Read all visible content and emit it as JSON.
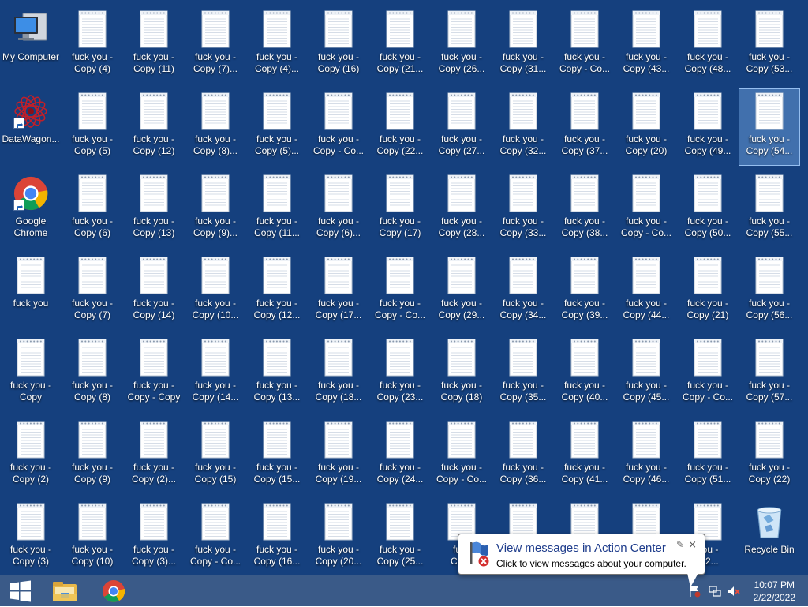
{
  "desktop": {
    "background": "#15407e",
    "columns": [
      [
        {
          "label": "My Computer",
          "kind": "computer"
        },
        {
          "label": "DataWagon...",
          "kind": "datawagon",
          "shortcut": true
        },
        {
          "label": "Google\nChrome",
          "kind": "chrome",
          "shortcut": true
        },
        {
          "label": "fuck you",
          "kind": "file"
        },
        {
          "label": "fuck you -\nCopy",
          "kind": "file"
        },
        {
          "label": "fuck you -\nCopy (2)",
          "kind": "file"
        },
        {
          "label": "fuck you -\nCopy (3)",
          "kind": "file"
        }
      ],
      [
        {
          "label": "fuck you -\nCopy (4)",
          "kind": "file"
        },
        {
          "label": "fuck you -\nCopy (5)",
          "kind": "file"
        },
        {
          "label": "fuck you -\nCopy (6)",
          "kind": "file"
        },
        {
          "label": "fuck you -\nCopy (7)",
          "kind": "file"
        },
        {
          "label": "fuck you -\nCopy (8)",
          "kind": "file"
        },
        {
          "label": "fuck you -\nCopy (9)",
          "kind": "file"
        },
        {
          "label": "fuck you -\nCopy (10)",
          "kind": "file"
        }
      ],
      [
        {
          "label": "fuck you -\nCopy (11)",
          "kind": "file"
        },
        {
          "label": "fuck you -\nCopy (12)",
          "kind": "file"
        },
        {
          "label": "fuck you -\nCopy (13)",
          "kind": "file"
        },
        {
          "label": "fuck you -\nCopy (14)",
          "kind": "file"
        },
        {
          "label": "fuck you -\nCopy - Copy",
          "kind": "file"
        },
        {
          "label": "fuck you -\nCopy (2)...",
          "kind": "file"
        },
        {
          "label": "fuck you -\nCopy (3)...",
          "kind": "file"
        }
      ],
      [
        {
          "label": "fuck you -\nCopy (7)...",
          "kind": "file"
        },
        {
          "label": "fuck you -\nCopy (8)...",
          "kind": "file"
        },
        {
          "label": "fuck you -\nCopy (9)...",
          "kind": "file"
        },
        {
          "label": "fuck you -\nCopy (10...",
          "kind": "file"
        },
        {
          "label": "fuck you -\nCopy (14...",
          "kind": "file"
        },
        {
          "label": "fuck you -\nCopy (15)",
          "kind": "file"
        },
        {
          "label": "fuck you -\nCopy - Co...",
          "kind": "file"
        }
      ],
      [
        {
          "label": "fuck you -\nCopy (4)...",
          "kind": "file"
        },
        {
          "label": "fuck you -\nCopy (5)...",
          "kind": "file"
        },
        {
          "label": "fuck you -\nCopy (11...",
          "kind": "file"
        },
        {
          "label": "fuck you -\nCopy (12...",
          "kind": "file"
        },
        {
          "label": "fuck you -\nCopy (13...",
          "kind": "file"
        },
        {
          "label": "fuck you -\nCopy (15...",
          "kind": "file"
        },
        {
          "label": "fuck you -\nCopy (16...",
          "kind": "file"
        }
      ],
      [
        {
          "label": "fuck you -\nCopy (16)",
          "kind": "file"
        },
        {
          "label": "fuck you -\nCopy - Co...",
          "kind": "file"
        },
        {
          "label": "fuck you -\nCopy (6)...",
          "kind": "file"
        },
        {
          "label": "fuck you -\nCopy (17...",
          "kind": "file"
        },
        {
          "label": "fuck you -\nCopy (18...",
          "kind": "file"
        },
        {
          "label": "fuck you -\nCopy (19...",
          "kind": "file"
        },
        {
          "label": "fuck you -\nCopy (20...",
          "kind": "file"
        }
      ],
      [
        {
          "label": "fuck you -\nCopy (21...",
          "kind": "file"
        },
        {
          "label": "fuck you -\nCopy (22...",
          "kind": "file"
        },
        {
          "label": "fuck you -\nCopy (17)",
          "kind": "file"
        },
        {
          "label": "fuck you -\nCopy - Co...",
          "kind": "file"
        },
        {
          "label": "fuck you -\nCopy (23...",
          "kind": "file"
        },
        {
          "label": "fuck you -\nCopy (24...",
          "kind": "file"
        },
        {
          "label": "fuck you -\nCopy (25...",
          "kind": "file"
        }
      ],
      [
        {
          "label": "fuck you -\nCopy (26...",
          "kind": "file"
        },
        {
          "label": "fuck you -\nCopy (27...",
          "kind": "file"
        },
        {
          "label": "fuck you -\nCopy (28...",
          "kind": "file"
        },
        {
          "label": "fuck you -\nCopy (29...",
          "kind": "file"
        },
        {
          "label": "fuck you -\nCopy (18)",
          "kind": "file"
        },
        {
          "label": "fuck you -\nCopy - Co...",
          "kind": "file"
        },
        {
          "label": "fuck\nCopy",
          "kind": "file"
        }
      ],
      [
        {
          "label": "fuck you -\nCopy (31...",
          "kind": "file"
        },
        {
          "label": "fuck you -\nCopy (32...",
          "kind": "file"
        },
        {
          "label": "fuck you -\nCopy (33...",
          "kind": "file"
        },
        {
          "label": "fuck you -\nCopy (34...",
          "kind": "file"
        },
        {
          "label": "fuck you -\nCopy (35...",
          "kind": "file"
        },
        {
          "label": "fuck you -\nCopy (36...",
          "kind": "file"
        },
        {
          "label": "",
          "kind": "file"
        }
      ],
      [
        {
          "label": "fuck you -\nCopy - Co...",
          "kind": "file"
        },
        {
          "label": "fuck you -\nCopy (37...",
          "kind": "file"
        },
        {
          "label": "fuck you -\nCopy (38...",
          "kind": "file"
        },
        {
          "label": "fuck you -\nCopy (39...",
          "kind": "file"
        },
        {
          "label": "fuck you -\nCopy (40...",
          "kind": "file"
        },
        {
          "label": "fuck you -\nCopy (41...",
          "kind": "file"
        },
        {
          "label": "",
          "kind": "file"
        }
      ],
      [
        {
          "label": "fuck you -\nCopy (43...",
          "kind": "file"
        },
        {
          "label": "fuck you -\nCopy (20)",
          "kind": "file"
        },
        {
          "label": "fuck you -\nCopy - Co...",
          "kind": "file"
        },
        {
          "label": "fuck you -\nCopy (44...",
          "kind": "file"
        },
        {
          "label": "fuck you -\nCopy (45...",
          "kind": "file"
        },
        {
          "label": "fuck you -\nCopy (46...",
          "kind": "file"
        },
        {
          "label": "",
          "kind": "file"
        }
      ],
      [
        {
          "label": "fuck you -\nCopy (48...",
          "kind": "file"
        },
        {
          "label": "fuck you -\nCopy (49...",
          "kind": "file"
        },
        {
          "label": "fuck you -\nCopy (50...",
          "kind": "file"
        },
        {
          "label": "fuck you -\nCopy (21)",
          "kind": "file"
        },
        {
          "label": "fuck you -\nCopy - Co...",
          "kind": "file"
        },
        {
          "label": "fuck you -\nCopy (51...",
          "kind": "file"
        },
        {
          "label": "you -\n(52...",
          "kind": "file"
        }
      ],
      [
        {
          "label": "fuck you -\nCopy (53...",
          "kind": "file"
        },
        {
          "label": "fuck you -\nCopy (54...",
          "kind": "file",
          "selected": true
        },
        {
          "label": "fuck you -\nCopy (55...",
          "kind": "file"
        },
        {
          "label": "fuck you -\nCopy (56...",
          "kind": "file"
        },
        {
          "label": "fuck you -\nCopy (57...",
          "kind": "file"
        },
        {
          "label": "fuck you -\nCopy (22)",
          "kind": "file"
        },
        {
          "label": "Recycle Bin",
          "kind": "recycle"
        }
      ]
    ]
  },
  "taskbar": {
    "background": "#3a5a88",
    "start_icon": "windows-start-icon",
    "pinned": [
      "file-explorer-icon",
      "chrome-icon"
    ],
    "tray_icons": [
      "action-center-flag-icon",
      "network-icon",
      "volume-muted-icon"
    ],
    "clock": {
      "time": "10:07 PM",
      "date": "2/22/2022"
    }
  },
  "balloon": {
    "title": "View messages in Action Center",
    "text": "Click to view messages about your computer.",
    "close_glyph": "×",
    "pin_glyph": "✎"
  }
}
